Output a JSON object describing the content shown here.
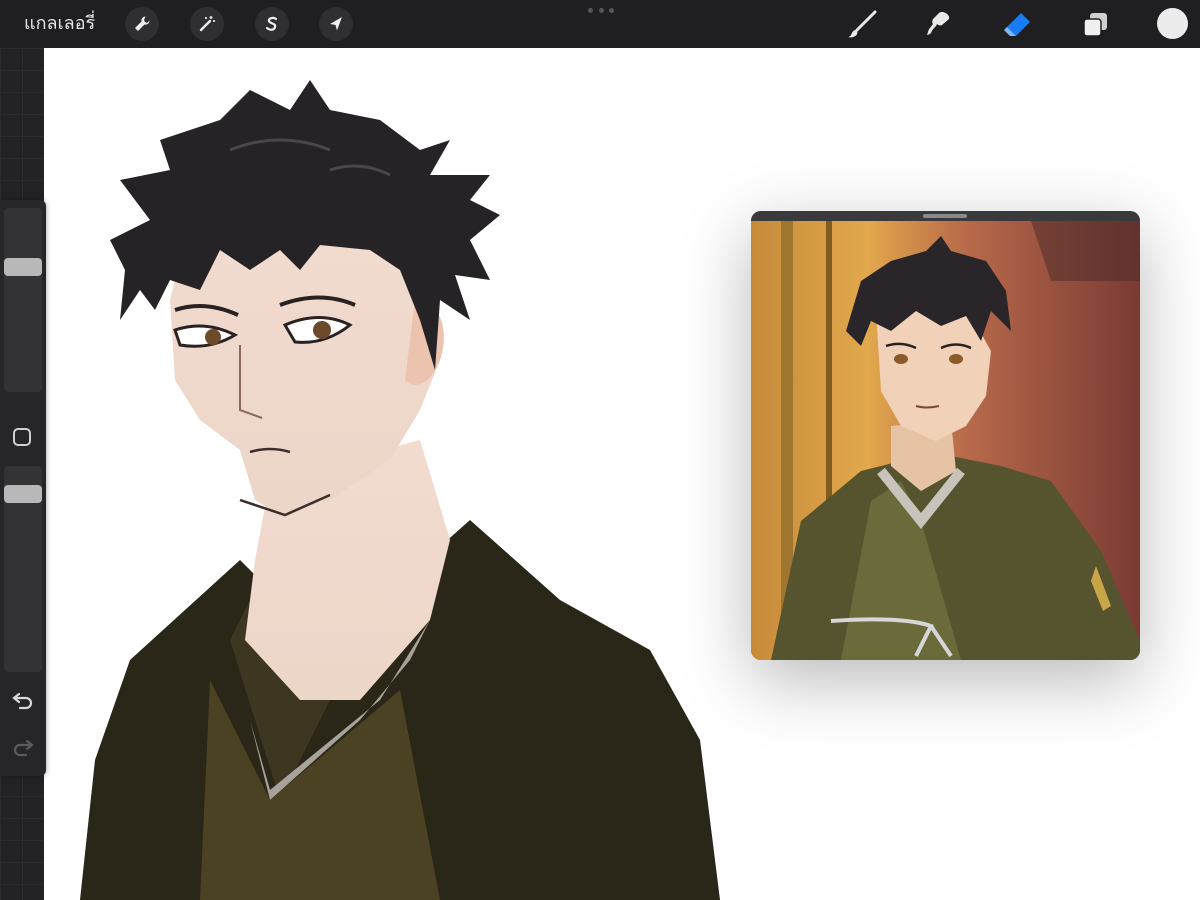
{
  "toolbar": {
    "gallery_label": "แกลเลอรี่",
    "left_tools": [
      {
        "icon": "wrench-icon",
        "name": "actions"
      },
      {
        "icon": "magic-wand-icon",
        "name": "adjustments"
      },
      {
        "icon": "selection-s-icon",
        "name": "selection"
      },
      {
        "icon": "arrow-cursor-icon",
        "name": "transform"
      }
    ],
    "right_tools": [
      {
        "icon": "brush-icon",
        "name": "paint"
      },
      {
        "icon": "smudge-icon",
        "name": "smudge"
      },
      {
        "icon": "eraser-icon",
        "name": "erase",
        "active": true
      },
      {
        "icon": "layers-icon",
        "name": "layers"
      }
    ],
    "active_color": "#ececec",
    "accent": "#1a7cf5"
  },
  "sidebar": {
    "brush_size_level": 0.55,
    "opacity_level": 0.95
  },
  "reference_window": {
    "visible": true
  }
}
